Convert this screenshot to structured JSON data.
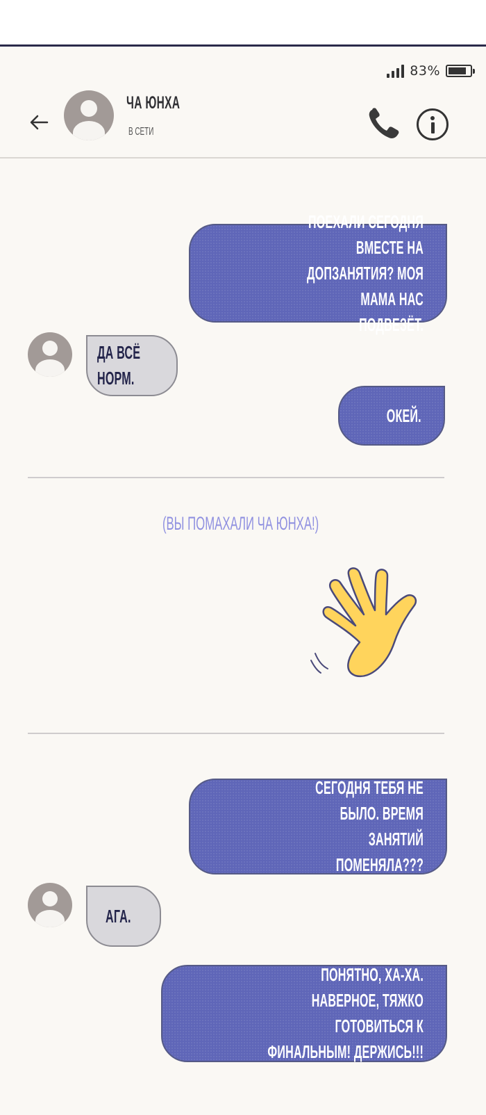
{
  "status_bar": {
    "battery_percent": "83%",
    "battery_level": 0.83
  },
  "header": {
    "back_icon": "arrow-left-icon",
    "contact_name": "ЧА ЮНХА",
    "contact_status": "В СЕТИ",
    "call_icon": "phone-icon",
    "info_icon": "info-icon"
  },
  "messages": [
    {
      "direction": "out",
      "text": "ПОЕХАЛИ СЕГОДНЯ ВМЕСТЕ НА\nДОПЗАНЯТИЯ? МОЯ МАМА НАС\nПОДВЕЗЁТ."
    },
    {
      "direction": "in",
      "text": "ДА ВСЁ НОРМ."
    },
    {
      "direction": "out",
      "text": "ОКЕЙ."
    },
    {
      "direction": "system",
      "text": "(ВЫ ПОМАХАЛИ ЧА ЮНХА!)",
      "sticker": "waving-hand-icon"
    },
    {
      "direction": "out",
      "text": "СЕГОДНЯ ТЕБЯ НЕ БЫЛО. ВРЕМЯ\nЗАНЯТИЙ ПОМЕНЯЛА???"
    },
    {
      "direction": "in",
      "text": "АГА."
    },
    {
      "direction": "out",
      "text": "ПОНЯТНО, ХА-ХА. НАВЕРНОЕ, ТЯЖКО\nГОТОВИТЬСЯ К ФИНАЛЬНЫМ! ДЕРЖИСЬ!!!"
    }
  ],
  "colors": {
    "outgoing_bubble": "#5f66b8",
    "incoming_bubble": "#d9d8dc",
    "system_text": "#8f90e0",
    "background": "#faf8f4"
  }
}
